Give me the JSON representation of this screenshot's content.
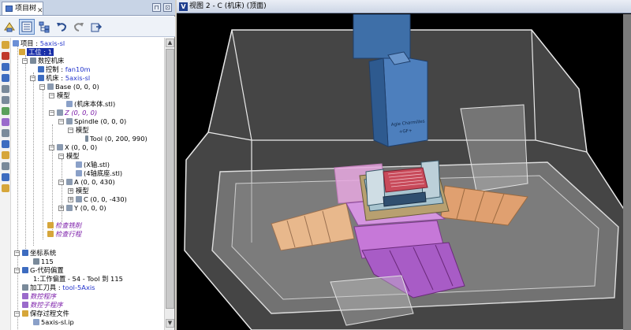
{
  "panel": {
    "tab_label": "项目树",
    "close_glyph": "✕",
    "pin_glyph": "⊓",
    "float_glyph": "⊡"
  },
  "toolbar": {
    "icons": [
      "move-icon",
      "list-view-icon",
      "tree-view-icon",
      "undo-icon",
      "redo-icon",
      "export-icon"
    ]
  },
  "tree": {
    "project": {
      "label": "项目",
      "value": "5axis-sl"
    },
    "setup": {
      "label": "工位",
      "value": "1"
    },
    "cnc": "数控机床",
    "control": {
      "label": "控制",
      "value": "fan10m"
    },
    "machine": {
      "label": "机床",
      "value": "5axis-sl"
    },
    "base": "Base (0, 0, 0)",
    "model1": "模型",
    "model1_file": "(机床本体.stl)",
    "z": "Z (0, 0, 0)",
    "spindle": "Spindle (0, 0, 0)",
    "model2": "模型",
    "tool": "Tool (0, 200, 990)",
    "x": "X (0, 0, 0)",
    "model3": "模型",
    "x_file": "(X轴.stl)",
    "axis4_file": "(4轴底座.stl)",
    "a": "A (0, 0, 430)",
    "model4": "模型",
    "c": "C (0, 0, -430)",
    "y": "Y (0, 0, 0)",
    "check_mill": "检查铣削",
    "check_travel": "检查行程",
    "coord": "坐标系统",
    "coord_val": "115",
    "gcode": "G-代码偏置",
    "gcode_item": "1:工作偏置 - 54 - Tool 到 115",
    "tooling": {
      "label": "加工刀具",
      "value": "tool-5Axis"
    },
    "nc_program": "数控程序",
    "nc_sub": "数控子程序",
    "save": "保存过程文件",
    "save_file": "5axis-sl.ip"
  },
  "viewport": {
    "title": "视图 2 - C (机床) (顶面)",
    "logo": "V",
    "spindle_text_1": "Agie Charmilles",
    "spindle_text_2": "+GF+"
  },
  "colors": {
    "selection": "#1a2fa8",
    "value_blue": "#2233cc",
    "italic_purple": "#7a1aa8",
    "spindle_blue": "#3e6fa8"
  }
}
